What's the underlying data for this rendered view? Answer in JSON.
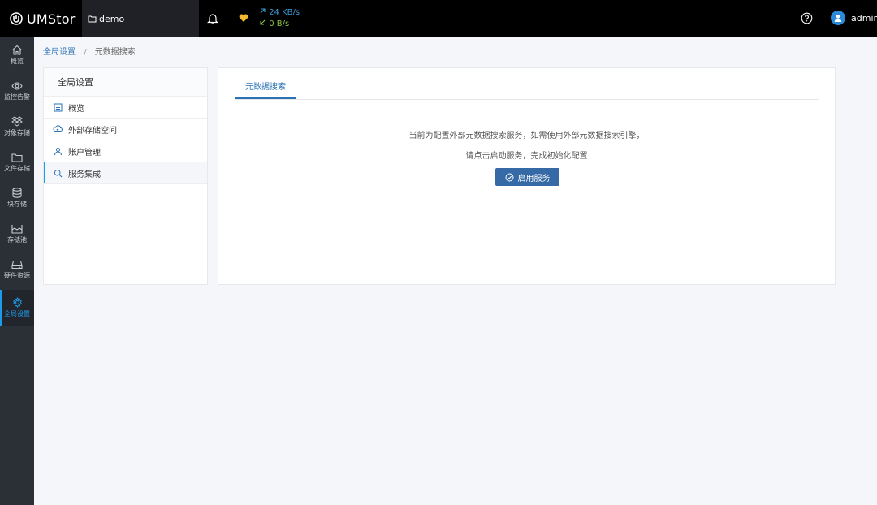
{
  "topbar": {
    "logo_text": "UMStor",
    "cluster_name": "demo",
    "traffic_up": "24 KB/s",
    "traffic_down": "0 B/s",
    "user_name": "admin",
    "icons": [
      "logo-icon",
      "folder-icon",
      "bell-icon",
      "heart-icon",
      "arrow-up-right-icon",
      "arrow-down-left-icon",
      "help-icon",
      "avatar-icon"
    ]
  },
  "nav": {
    "items": [
      {
        "label": "概览",
        "icon": "home-icon"
      },
      {
        "label": "监控告警",
        "icon": "eye-icon"
      },
      {
        "label": "对象存储",
        "icon": "dropbox-icon"
      },
      {
        "label": "文件存储",
        "icon": "folder-icon"
      },
      {
        "label": "块存储",
        "icon": "database-icon"
      },
      {
        "label": "存储池",
        "icon": "pool-icon"
      },
      {
        "label": "硬件资源",
        "icon": "hard-drive-icon"
      },
      {
        "label": "全局设置",
        "icon": "gear-icon",
        "active": true
      }
    ]
  },
  "breadcrumb": {
    "root": "全局设置",
    "separator": "/",
    "current": "元数据搜索"
  },
  "settings": {
    "title": "全局设置",
    "items": [
      {
        "label": "概览",
        "icon": "list-icon"
      },
      {
        "label": "外部存储空间",
        "icon": "cloud-icon"
      },
      {
        "label": "账户管理",
        "icon": "user-icon"
      },
      {
        "label": "服务集成",
        "icon": "search-icon",
        "active": true
      }
    ]
  },
  "main": {
    "tab_label": "元数据搜索",
    "notice_line1": "当前为配置外部元数据搜索服务，如需使用外部元数据搜索引擎，",
    "notice_line2": "请点击启动服务，完成初始化配置",
    "button_label": "启用服务"
  },
  "colors": {
    "accent": "#1e9be8",
    "link": "#2b72b4",
    "button": "#356aa6",
    "topbar": "#000000",
    "sidebar": "#2b2f36",
    "traffic_up": "#3b9ad9",
    "traffic_down": "#8bc34a",
    "heart": "#f5b82e"
  }
}
